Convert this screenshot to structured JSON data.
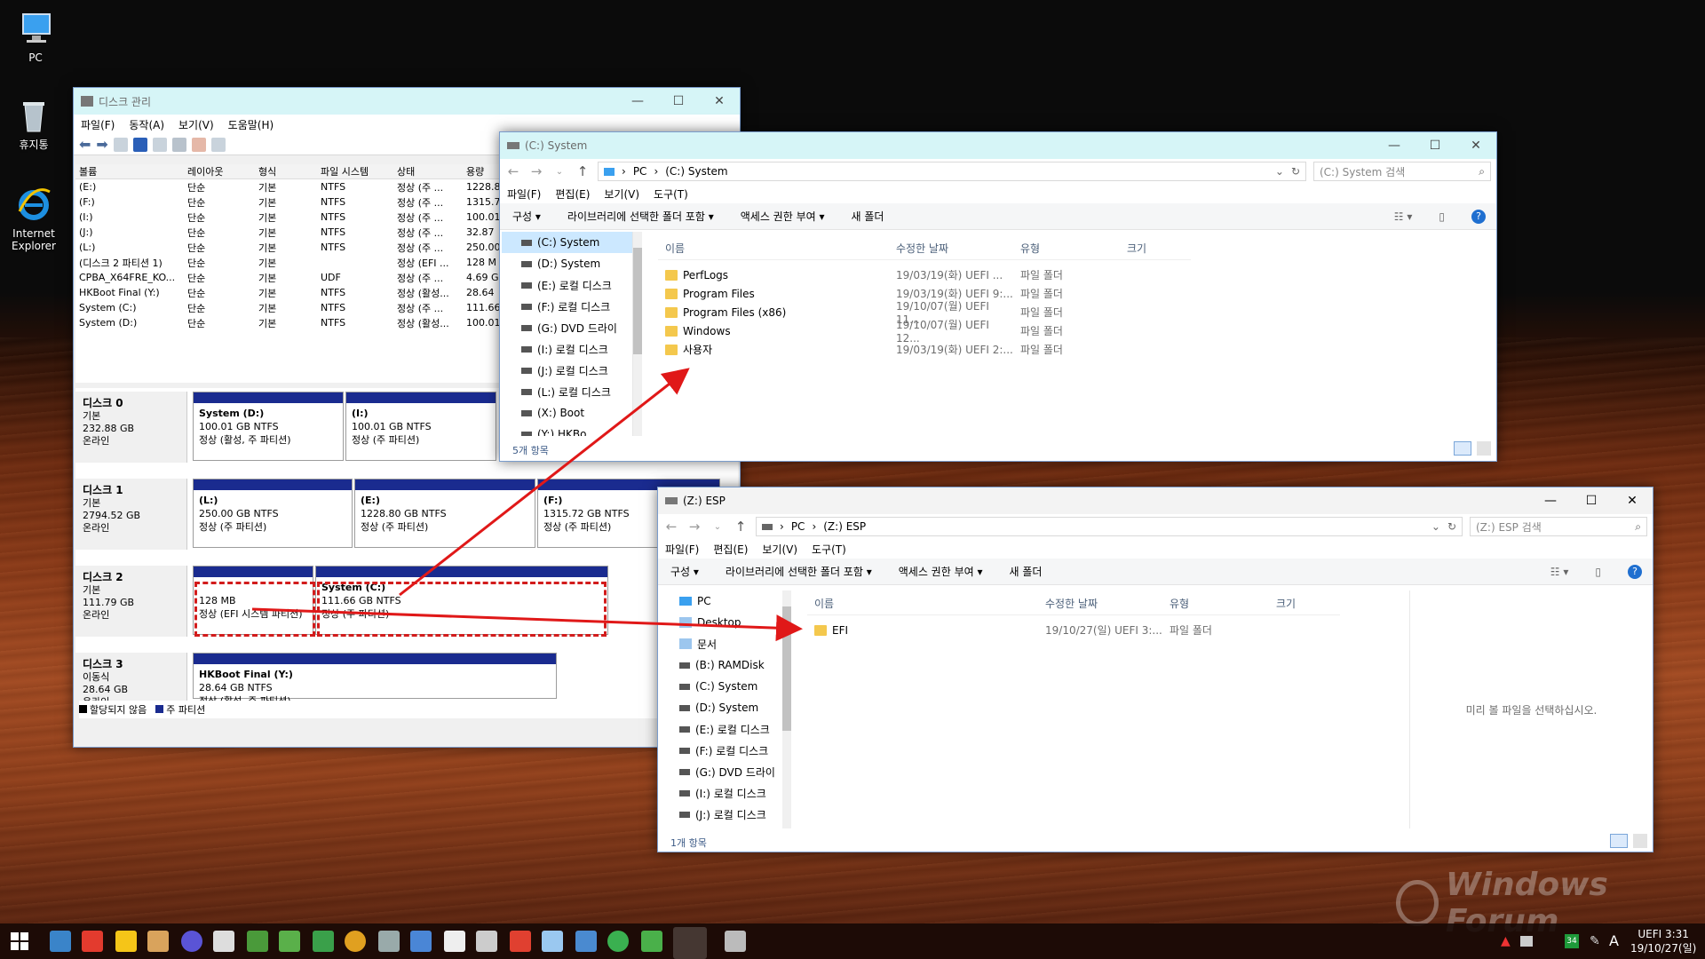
{
  "desktop": {
    "icons": [
      {
        "label": "PC",
        "icon": "pc-icon"
      },
      {
        "label": "휴지통",
        "icon": "recycle-bin-icon"
      },
      {
        "label": "Internet Explorer",
        "icon": "internet-explorer-icon"
      }
    ],
    "watermark": "Windows Forum"
  },
  "diskmgmt": {
    "title": "디스크 관리",
    "menus": [
      "파일(F)",
      "동작(A)",
      "보기(V)",
      "도움말(H)"
    ],
    "columns": [
      "볼륨",
      "레이아웃",
      "형식",
      "파일 시스템",
      "상태",
      "용량"
    ],
    "volumes": [
      [
        "(E:)",
        "단순",
        "기본",
        "NTFS",
        "정상 (주 ...",
        "1228.8"
      ],
      [
        "(F:)",
        "단순",
        "기본",
        "NTFS",
        "정상 (주 ...",
        "1315.7"
      ],
      [
        "(I:)",
        "단순",
        "기본",
        "NTFS",
        "정상 (주 ...",
        "100.01"
      ],
      [
        "(J:)",
        "단순",
        "기본",
        "NTFS",
        "정상 (주 ...",
        "32.87"
      ],
      [
        "(L:)",
        "단순",
        "기본",
        "NTFS",
        "정상 (주 ...",
        "250.00"
      ],
      [
        "(디스크 2 파티션 1)",
        "단순",
        "기본",
        "",
        "정상 (EFI ...",
        "128 M"
      ],
      [
        "CPBA_X64FRE_KO...",
        "단순",
        "기본",
        "UDF",
        "정상 (주 ...",
        "4.69 G"
      ],
      [
        "HKBoot Final (Y:)",
        "단순",
        "기본",
        "NTFS",
        "정상 (활성...",
        "28.64"
      ],
      [
        "System (C:)",
        "단순",
        "기본",
        "NTFS",
        "정상 (주 ...",
        "111.66"
      ],
      [
        "System (D:)",
        "단순",
        "기본",
        "NTFS",
        "정상 (활성...",
        "100.01"
      ]
    ],
    "disks": [
      {
        "name": "디스크 0",
        "type": "기본",
        "size": "232.88 GB",
        "status": "온라인",
        "parts": [
          {
            "title": "System  (D:)",
            "size": "100.01 GB NTFS",
            "status": "정상 (활성, 주 파티션)"
          },
          {
            "title": "(I:)",
            "size": "100.01 GB NTFS",
            "status": "정상 (주 파티션)"
          }
        ]
      },
      {
        "name": "디스크 1",
        "type": "기본",
        "size": "2794.52 GB",
        "status": "온라인",
        "parts": [
          {
            "title": "(L:)",
            "size": "250.00 GB NTFS",
            "status": "정상 (주 파티션)"
          },
          {
            "title": "(E:)",
            "size": "1228.80 GB NTFS",
            "status": "정상 (주 파티션)"
          },
          {
            "title": "(F:)",
            "size": "1315.72 GB NTFS",
            "status": "정상 (주 파티션)"
          }
        ]
      },
      {
        "name": "디스크 2",
        "type": "기본",
        "size": "111.79 GB",
        "status": "온라인",
        "parts": [
          {
            "title": "",
            "size": "128 MB",
            "status": "정상 (EFI 시스템 파티션)"
          },
          {
            "title": "System  (C:)",
            "size": "111.66 GB NTFS",
            "status": "정상 (주 파티션)"
          }
        ]
      },
      {
        "name": "디스크 3",
        "type": "이동식",
        "size": "28.64 GB",
        "status": "온라인",
        "parts": [
          {
            "title": "HKBoot Final  (Y:)",
            "size": "28.64 GB NTFS",
            "status": "정상 (활성, 주 파티션)"
          }
        ]
      }
    ],
    "legend": [
      "할당되지 않음",
      "주 파티션"
    ]
  },
  "explorer_c": {
    "title": "(C:) System",
    "path": [
      "PC",
      "(C:) System"
    ],
    "search_placeholder": "(C:) System 검색",
    "menus": [
      "파일(F)",
      "편집(E)",
      "보기(V)",
      "도구(T)"
    ],
    "commands": [
      "구성 ▾",
      "라이브러리에 선택한 폴더 포함 ▾",
      "액세스 권한 부여 ▾",
      "새 폴더"
    ],
    "nav": [
      "(C:) System",
      "(D:) System",
      "(E:) 로컬 디스크",
      "(F:) 로컬 디스크",
      "(G:) DVD 드라이",
      "(I:) 로컬 디스크",
      "(J:) 로컬 디스크",
      "(L:) 로컬 디스크",
      "(X:) Boot",
      "(Y:) HKBo"
    ],
    "columns": [
      "이름",
      "수정한 날짜",
      "유형",
      "크기"
    ],
    "files": [
      {
        "name": "PerfLogs",
        "date": "19/03/19(화) UEFI ...",
        "type": "파일 폴더"
      },
      {
        "name": "Program Files",
        "date": "19/03/19(화) UEFI 9:...",
        "type": "파일 폴더"
      },
      {
        "name": "Program Files (x86)",
        "date": "19/10/07(월) UEFI 11...",
        "type": "파일 폴더"
      },
      {
        "name": "Windows",
        "date": "19/10/07(월) UEFI 12...",
        "type": "파일 폴더"
      },
      {
        "name": "사용자",
        "date": "19/03/19(화) UEFI 2:...",
        "type": "파일 폴더"
      }
    ],
    "status": "5개 항목"
  },
  "explorer_z": {
    "title": "(Z:) ESP",
    "path": [
      "PC",
      "(Z:) ESP"
    ],
    "search_placeholder": "(Z:) ESP 검색",
    "menus": [
      "파일(F)",
      "편집(E)",
      "보기(V)",
      "도구(T)"
    ],
    "commands": [
      "구성 ▾",
      "라이브러리에 선택한 폴더 포함 ▾",
      "액세스 권한 부여 ▾",
      "새 폴더"
    ],
    "nav": [
      "PC",
      "Desktop",
      "문서",
      "(B:) RAMDisk",
      "(C:) System",
      "(D:) System",
      "(E:) 로컬 디스크",
      "(F:) 로컬 디스크",
      "(G:) DVD 드라이",
      "(I:) 로컬 디스크",
      "(J:) 로컬 디스크"
    ],
    "columns": [
      "이름",
      "수정한 날짜",
      "유형",
      "크기"
    ],
    "files": [
      {
        "name": "EFI",
        "date": "19/10/27(일) UEFI 3:...",
        "type": "파일 폴더"
      }
    ],
    "preview": "미리 볼 파일을 선택하십시오.",
    "status": "1개 항목"
  },
  "taskbar": {
    "clock_line1": "UEFI  3:31",
    "clock_line2": "19/10/27(일)",
    "ime": "A",
    "badge": "34"
  }
}
